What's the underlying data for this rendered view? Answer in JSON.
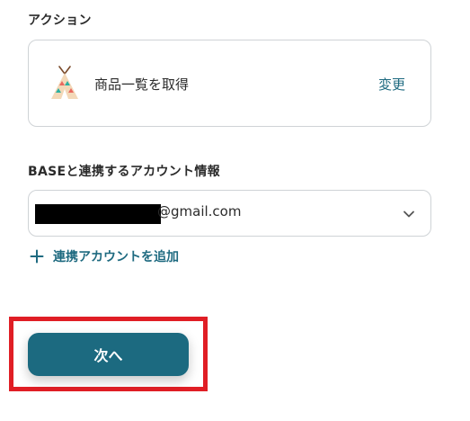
{
  "action_section": {
    "label": "アクション",
    "card": {
      "app_icon": "base-teepee-icon",
      "action_name": "商品一覧を取得",
      "change_label": "変更"
    }
  },
  "account_section": {
    "label": "BASEと連携するアカウント情報",
    "selected_account_suffix": "@gmail.com",
    "chevron_icon": "chevron-down-icon",
    "add_account_label": "連携アカウントを追加",
    "add_icon": "plus-icon"
  },
  "footer": {
    "next_label": "次へ"
  },
  "colors": {
    "accent": "#1c6a80",
    "link": "#1e6a80",
    "highlight": "#e01e25",
    "border": "#cfd3d6"
  }
}
